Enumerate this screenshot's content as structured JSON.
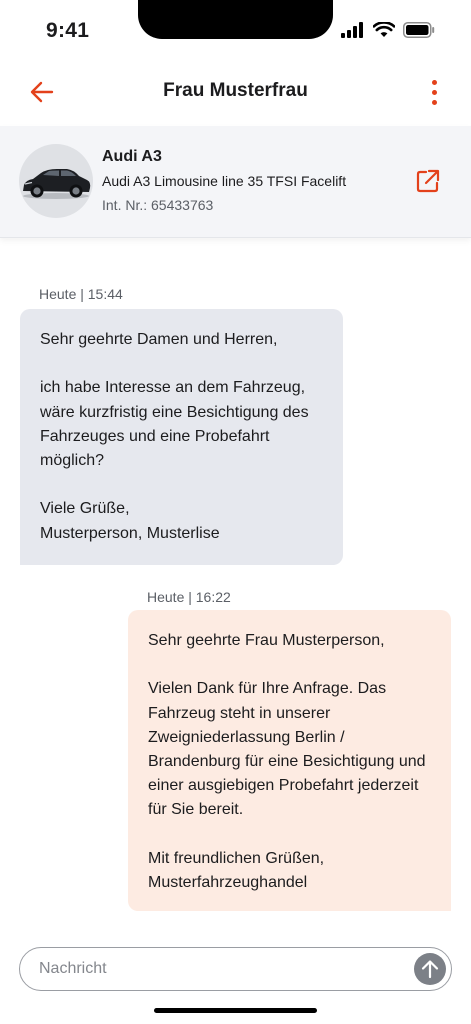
{
  "status_bar": {
    "time": "9:41"
  },
  "header": {
    "title": "Frau Musterfrau",
    "back_icon": "arrow-left-icon",
    "menu_icon": "more-vertical-icon",
    "accent_color": "#e3411b"
  },
  "vehicle": {
    "name": "Audi A3",
    "model": "Audi A3 Limousine line 35 TFSI Facelift",
    "internal_number": "Int. Nr.: 65433763",
    "link_icon": "external-link-icon"
  },
  "messages": [
    {
      "direction": "incoming",
      "timestamp": "Heute | 15:44",
      "text": "Sehr geehrte Damen und Herren,\n\nich habe Interesse an dem Fahrzeug, wäre kurzfristig eine Besichtigung des Fahrzeuges und eine Probefahrt möglich?\n\nViele Grüße,\nMusterperson, Musterlise",
      "bubble_color": "#e6e8ee"
    },
    {
      "direction": "outgoing",
      "timestamp": "Heute | 16:22",
      "text": "Sehr geehrte Frau Musterperson,\n\nVielen Dank für Ihre Anfrage. Das Fahrzeug steht in unserer Zweigniederlassung Berlin / Brandenburg für eine Besichtigung und einer ausgiebigen Probefahrt jederzeit für Sie bereit.\n\nMit freundlichen Grüßen,\nMusterfahrzeughandel",
      "bubble_color": "#fdebe2"
    }
  ],
  "composer": {
    "placeholder": "Nachricht",
    "value": "",
    "send_icon": "arrow-up-icon"
  }
}
